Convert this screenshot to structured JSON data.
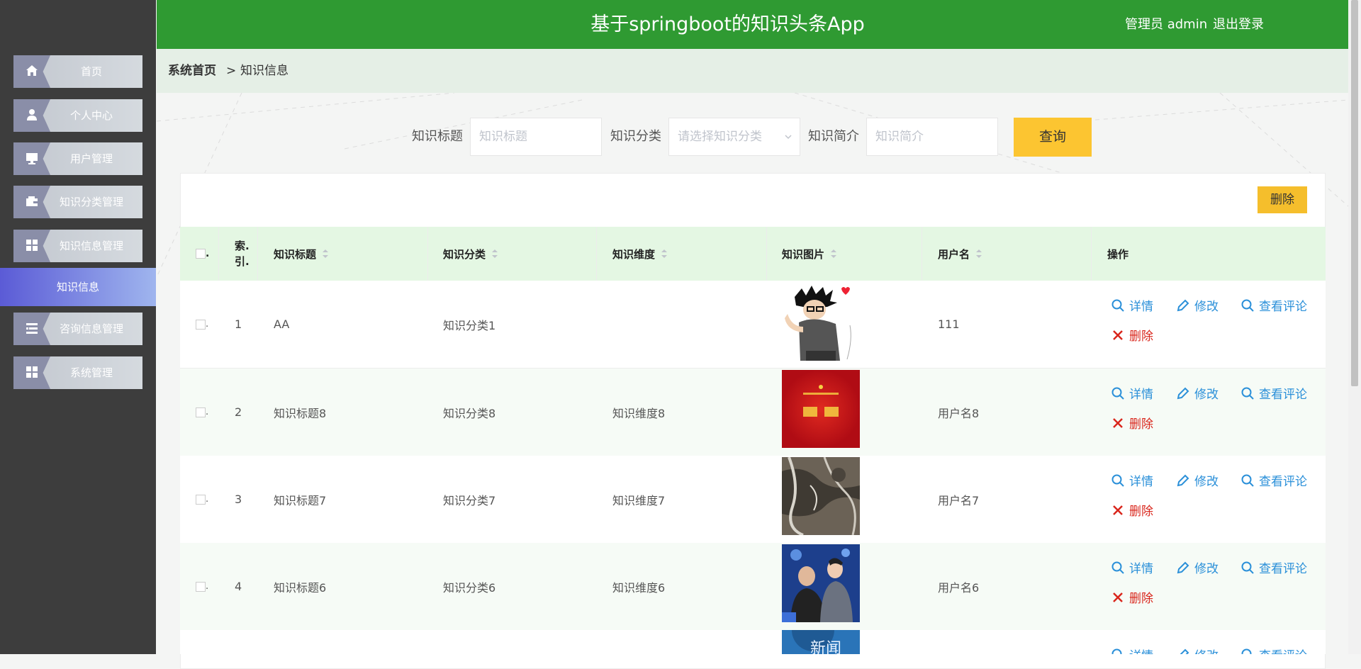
{
  "header": {
    "title": "基于springboot的知识头条App",
    "user": "管理员 admin",
    "logout": "退出登录"
  },
  "sidebar": {
    "items": [
      {
        "label": "首页",
        "icon": "home-icon"
      },
      {
        "label": "个人中心",
        "icon": "user-icon"
      },
      {
        "label": "用户管理",
        "icon": "monitor-icon"
      },
      {
        "label": "知识分类管理",
        "icon": "wallet-icon"
      },
      {
        "label": "知识信息管理",
        "icon": "grid-icon"
      },
      {
        "label": "咨询信息管理",
        "icon": "list-icon"
      },
      {
        "label": "系统管理",
        "icon": "grid-icon"
      }
    ],
    "active_sub": "知识信息"
  },
  "breadcrumb": {
    "home": "系统首页",
    "sep": ">",
    "current": "知识信息"
  },
  "search": {
    "title_label": "知识标题",
    "title_placeholder": "知识标题",
    "category_label": "知识分类",
    "category_placeholder": "请选择知识分类",
    "intro_label": "知识简介",
    "intro_placeholder": "知识简介",
    "query_button": "查询"
  },
  "toolbar": {
    "delete_button": "删除"
  },
  "table": {
    "columns": [
      "索引",
      "知识标题",
      "知识分类",
      "知识维度",
      "知识图片",
      "用户名",
      "操作"
    ],
    "index_header_line1": "索.",
    "index_header_line2": "引.",
    "rows": [
      {
        "index": "1",
        "title": "AA",
        "category": "知识分类1",
        "dimension": "",
        "image": "anime-boy-photo",
        "username": "111"
      },
      {
        "index": "2",
        "title": "知识标题8",
        "category": "知识分类8",
        "dimension": "知识维度8",
        "image": "red-notice-poster",
        "username": "用户名8"
      },
      {
        "index": "3",
        "title": "知识标题7",
        "category": "知识分类7",
        "dimension": "知识维度7",
        "image": "aerial-landscape-photo",
        "username": "用户名7"
      },
      {
        "index": "4",
        "title": "知识标题6",
        "category": "知识分类6",
        "dimension": "知识维度6",
        "image": "stage-people-photo",
        "username": "用户名6"
      }
    ],
    "actions": {
      "detail": "详情",
      "edit": "修改",
      "comments": "查看评论",
      "delete": "删除"
    },
    "partial_image_text": "新闻"
  },
  "colors": {
    "header": "#2f9a32",
    "sidebar": "#3d3d3d",
    "query_button": "#fcc531",
    "link": "#2b90d9",
    "delete": "#d9261c"
  }
}
